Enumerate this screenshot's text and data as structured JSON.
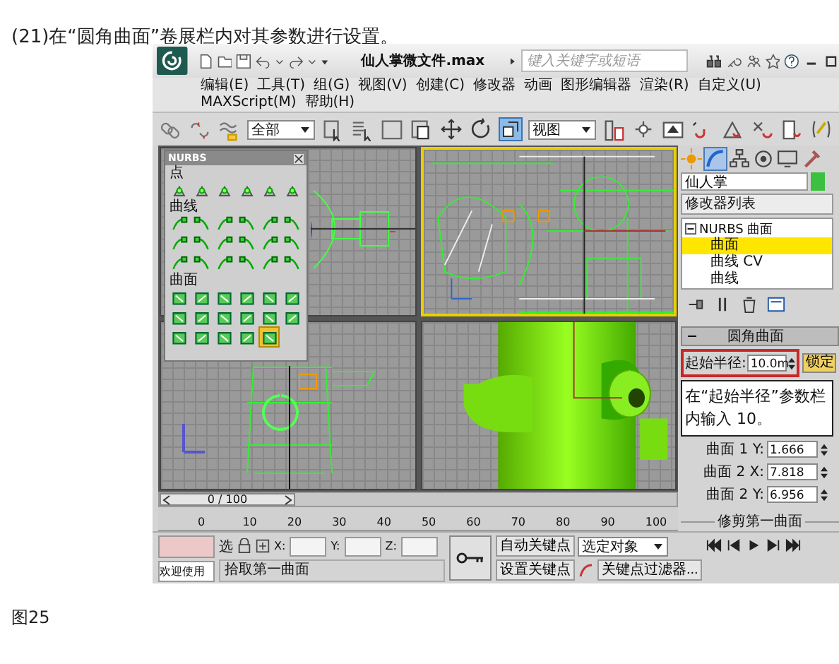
{
  "caption": "(21)在“圆角曲面”卷展栏内对其参数进行设置。",
  "app": {
    "title": "仙人掌微文件.max",
    "search": {
      "placeholder": "键入关键字或短语"
    },
    "menu": [
      "编辑(E)",
      "工具(T)",
      "组(G)",
      "视图(V)",
      "创建(C)",
      "修改器",
      "动画",
      "图形编辑器",
      "渲染(R)",
      "自定义(U)",
      "MAXScript(M)",
      "帮助(H)"
    ],
    "toolbar": {
      "selection_filter": "全部",
      "reference_coord": "视图"
    },
    "nurbs_panel": {
      "title": "NURBS",
      "sections": [
        {
          "label": "点",
          "tools": [
            {
              "selected": false
            },
            {
              "selected": false
            },
            {
              "selected": false
            },
            {
              "selected": false
            },
            {
              "selected": false
            },
            {
              "selected": false
            }
          ]
        },
        {
          "label": "曲线",
          "tools": [
            {
              "selected": false
            },
            {
              "selected": false
            },
            {
              "selected": false
            },
            {
              "selected": false
            },
            {
              "selected": false
            },
            {
              "selected": false
            },
            {
              "selected": false
            },
            {
              "selected": false
            },
            {
              "selected": false
            },
            {
              "selected": false
            },
            {
              "selected": false
            },
            {
              "selected": false
            },
            {
              "selected": false
            },
            {
              "selected": false
            },
            {
              "selected": false
            },
            {
              "selected": false
            },
            {
              "selected": false
            },
            {
              "selected": false
            }
          ]
        },
        {
          "label": "曲面",
          "tools": [
            {
              "selected": false
            },
            {
              "selected": false
            },
            {
              "selected": false
            },
            {
              "selected": false
            },
            {
              "selected": false
            },
            {
              "selected": false
            },
            {
              "selected": false
            },
            {
              "selected": false
            },
            {
              "selected": false
            },
            {
              "selected": false
            },
            {
              "selected": false
            },
            {
              "selected": false
            },
            {
              "selected": false
            },
            {
              "selected": false
            },
            {
              "selected": false
            },
            {
              "selected": false
            },
            {
              "selected": true
            }
          ]
        }
      ]
    },
    "command_panel": {
      "object_name": "仙人掌",
      "modifier_list": "修改器列表",
      "stack": [
        {
          "label": "NURBS 曲面",
          "expanded": true,
          "children": [
            {
              "label": "曲面",
              "selected": true
            },
            {
              "label": "曲线 CV",
              "selected": false
            },
            {
              "label": "曲线",
              "selected": false
            }
          ]
        }
      ],
      "rollout": {
        "title": "圆角曲面",
        "start_radius": {
          "label": "起始半径:",
          "value": "10.0m"
        },
        "lock_button": "锁定",
        "tooltip": "在“起始半径”参数栏内输入 10。",
        "params": [
          {
            "label": "曲面 1 Y:",
            "value": "1.666"
          },
          {
            "label": "曲面 2 X:",
            "value": "7.818"
          },
          {
            "label": "曲面 2 Y:",
            "value": "6.956"
          }
        ],
        "trim_group": "修剪第一曲面"
      }
    },
    "timeline": {
      "position": "0 / 100",
      "level": 0,
      "ruler": [
        "0",
        "10",
        "20",
        "30",
        "40",
        "50",
        "60",
        "70",
        "80",
        "90",
        "100"
      ]
    },
    "status": {
      "welcome": "欢迎使用",
      "prompt": "拾取第一曲面",
      "select_label": "选",
      "coords": [
        "X:",
        "Y:",
        "Z:"
      ],
      "auto_key": "自动关键点",
      "key_mode": "选定对象",
      "set_key": "设置关键点",
      "key_filters": "关键点过滤器..."
    }
  },
  "figure_label": "图25"
}
